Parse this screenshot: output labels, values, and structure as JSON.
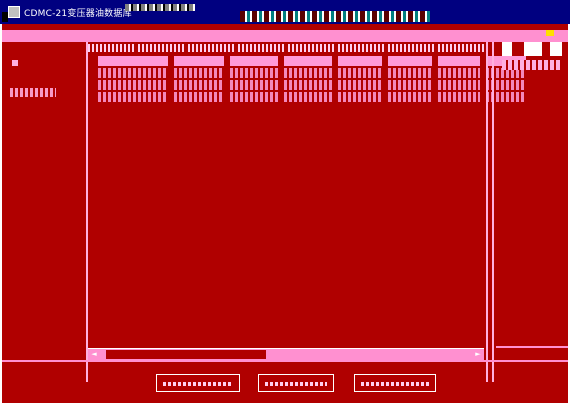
{
  "window": {
    "title": "CDMC-21变压器油数据库"
  },
  "colors": {
    "titlebar": "#000080",
    "background": "#b00000",
    "accent": "#ff90d0"
  },
  "icons": {
    "app": "window-app-icon"
  }
}
